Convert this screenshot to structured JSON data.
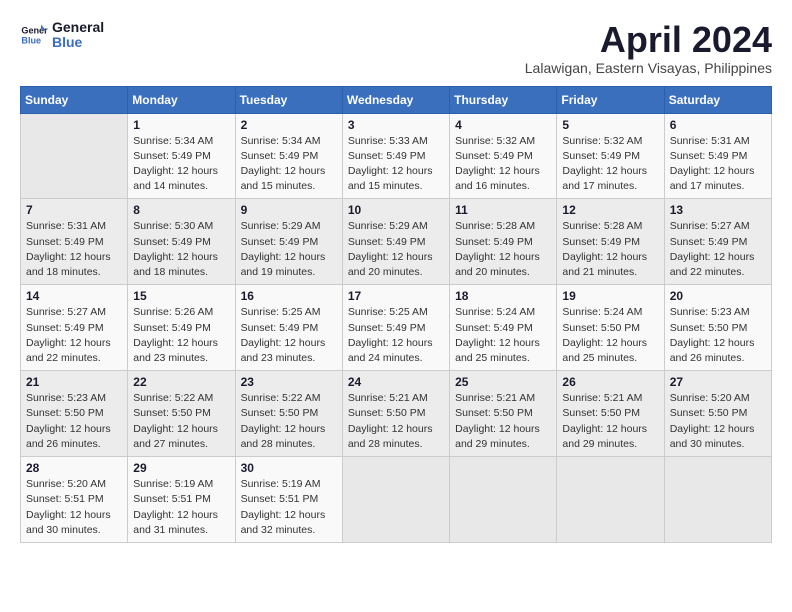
{
  "header": {
    "logo_general": "General",
    "logo_blue": "Blue",
    "title": "April 2024",
    "location": "Lalawigan, Eastern Visayas, Philippines"
  },
  "calendar": {
    "days_of_week": [
      "Sunday",
      "Monday",
      "Tuesday",
      "Wednesday",
      "Thursday",
      "Friday",
      "Saturday"
    ],
    "weeks": [
      [
        {
          "day": "",
          "empty": true
        },
        {
          "day": "1",
          "sunrise": "5:34 AM",
          "sunset": "5:49 PM",
          "daylight": "12 hours and 14 minutes."
        },
        {
          "day": "2",
          "sunrise": "5:34 AM",
          "sunset": "5:49 PM",
          "daylight": "12 hours and 15 minutes."
        },
        {
          "day": "3",
          "sunrise": "5:33 AM",
          "sunset": "5:49 PM",
          "daylight": "12 hours and 15 minutes."
        },
        {
          "day": "4",
          "sunrise": "5:32 AM",
          "sunset": "5:49 PM",
          "daylight": "12 hours and 16 minutes."
        },
        {
          "day": "5",
          "sunrise": "5:32 AM",
          "sunset": "5:49 PM",
          "daylight": "12 hours and 17 minutes."
        },
        {
          "day": "6",
          "sunrise": "5:31 AM",
          "sunset": "5:49 PM",
          "daylight": "12 hours and 17 minutes."
        }
      ],
      [
        {
          "day": "7",
          "sunrise": "5:31 AM",
          "sunset": "5:49 PM",
          "daylight": "12 hours and 18 minutes."
        },
        {
          "day": "8",
          "sunrise": "5:30 AM",
          "sunset": "5:49 PM",
          "daylight": "12 hours and 18 minutes."
        },
        {
          "day": "9",
          "sunrise": "5:29 AM",
          "sunset": "5:49 PM",
          "daylight": "12 hours and 19 minutes."
        },
        {
          "day": "10",
          "sunrise": "5:29 AM",
          "sunset": "5:49 PM",
          "daylight": "12 hours and 20 minutes."
        },
        {
          "day": "11",
          "sunrise": "5:28 AM",
          "sunset": "5:49 PM",
          "daylight": "12 hours and 20 minutes."
        },
        {
          "day": "12",
          "sunrise": "5:28 AM",
          "sunset": "5:49 PM",
          "daylight": "12 hours and 21 minutes."
        },
        {
          "day": "13",
          "sunrise": "5:27 AM",
          "sunset": "5:49 PM",
          "daylight": "12 hours and 22 minutes."
        }
      ],
      [
        {
          "day": "14",
          "sunrise": "5:27 AM",
          "sunset": "5:49 PM",
          "daylight": "12 hours and 22 minutes."
        },
        {
          "day": "15",
          "sunrise": "5:26 AM",
          "sunset": "5:49 PM",
          "daylight": "12 hours and 23 minutes."
        },
        {
          "day": "16",
          "sunrise": "5:25 AM",
          "sunset": "5:49 PM",
          "daylight": "12 hours and 23 minutes."
        },
        {
          "day": "17",
          "sunrise": "5:25 AM",
          "sunset": "5:49 PM",
          "daylight": "12 hours and 24 minutes."
        },
        {
          "day": "18",
          "sunrise": "5:24 AM",
          "sunset": "5:49 PM",
          "daylight": "12 hours and 25 minutes."
        },
        {
          "day": "19",
          "sunrise": "5:24 AM",
          "sunset": "5:50 PM",
          "daylight": "12 hours and 25 minutes."
        },
        {
          "day": "20",
          "sunrise": "5:23 AM",
          "sunset": "5:50 PM",
          "daylight": "12 hours and 26 minutes."
        }
      ],
      [
        {
          "day": "21",
          "sunrise": "5:23 AM",
          "sunset": "5:50 PM",
          "daylight": "12 hours and 26 minutes."
        },
        {
          "day": "22",
          "sunrise": "5:22 AM",
          "sunset": "5:50 PM",
          "daylight": "12 hours and 27 minutes."
        },
        {
          "day": "23",
          "sunrise": "5:22 AM",
          "sunset": "5:50 PM",
          "daylight": "12 hours and 28 minutes."
        },
        {
          "day": "24",
          "sunrise": "5:21 AM",
          "sunset": "5:50 PM",
          "daylight": "12 hours and 28 minutes."
        },
        {
          "day": "25",
          "sunrise": "5:21 AM",
          "sunset": "5:50 PM",
          "daylight": "12 hours and 29 minutes."
        },
        {
          "day": "26",
          "sunrise": "5:21 AM",
          "sunset": "5:50 PM",
          "daylight": "12 hours and 29 minutes."
        },
        {
          "day": "27",
          "sunrise": "5:20 AM",
          "sunset": "5:50 PM",
          "daylight": "12 hours and 30 minutes."
        }
      ],
      [
        {
          "day": "28",
          "sunrise": "5:20 AM",
          "sunset": "5:51 PM",
          "daylight": "12 hours and 30 minutes."
        },
        {
          "day": "29",
          "sunrise": "5:19 AM",
          "sunset": "5:51 PM",
          "daylight": "12 hours and 31 minutes."
        },
        {
          "day": "30",
          "sunrise": "5:19 AM",
          "sunset": "5:51 PM",
          "daylight": "12 hours and 32 minutes."
        },
        {
          "day": "",
          "empty": true
        },
        {
          "day": "",
          "empty": true
        },
        {
          "day": "",
          "empty": true
        },
        {
          "day": "",
          "empty": true
        }
      ]
    ]
  }
}
